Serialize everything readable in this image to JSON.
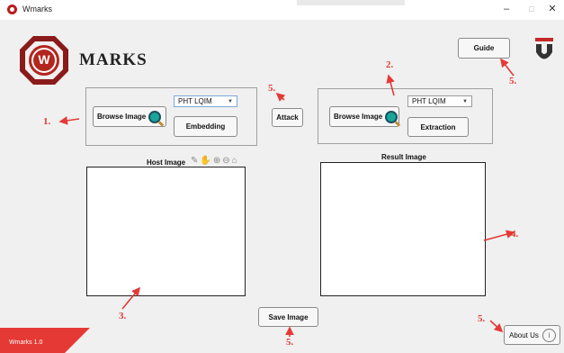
{
  "window": {
    "title": "Wmarks",
    "minimize": "–",
    "maximize": "□",
    "close": "✕"
  },
  "brand": {
    "logo_letter": "W",
    "name": "MARKS"
  },
  "guide_label": "Guide",
  "left_panel": {
    "browse_label": "Browse Image",
    "method": "PHT LQIM",
    "embed_label": "Embedding"
  },
  "attack_label": "Attack",
  "right_panel": {
    "browse_label": "Browse Image",
    "method": "PHT LQIM",
    "extract_label": "Extraction"
  },
  "host_image_label": "Host Image",
  "result_image_label": "Result Image",
  "save_label": "Save Image",
  "about_label": "About Us",
  "version": "Wmarks 1.0",
  "annotations": {
    "a1": "1.",
    "a2": "2.",
    "a3": "3.",
    "a4": "4.",
    "a5_attack": "5.",
    "a5_guide": "5.",
    "a5_save": "5.",
    "a5_about": "5."
  },
  "colors": {
    "accent_red": "#e53935",
    "logo_red": "#8b1a1a",
    "univ_red": "#c62828"
  },
  "icons": [
    "search-icon",
    "pencil-icon",
    "hand-icon",
    "zoom-in-icon",
    "zoom-out-icon",
    "home-icon",
    "info-icon"
  ]
}
